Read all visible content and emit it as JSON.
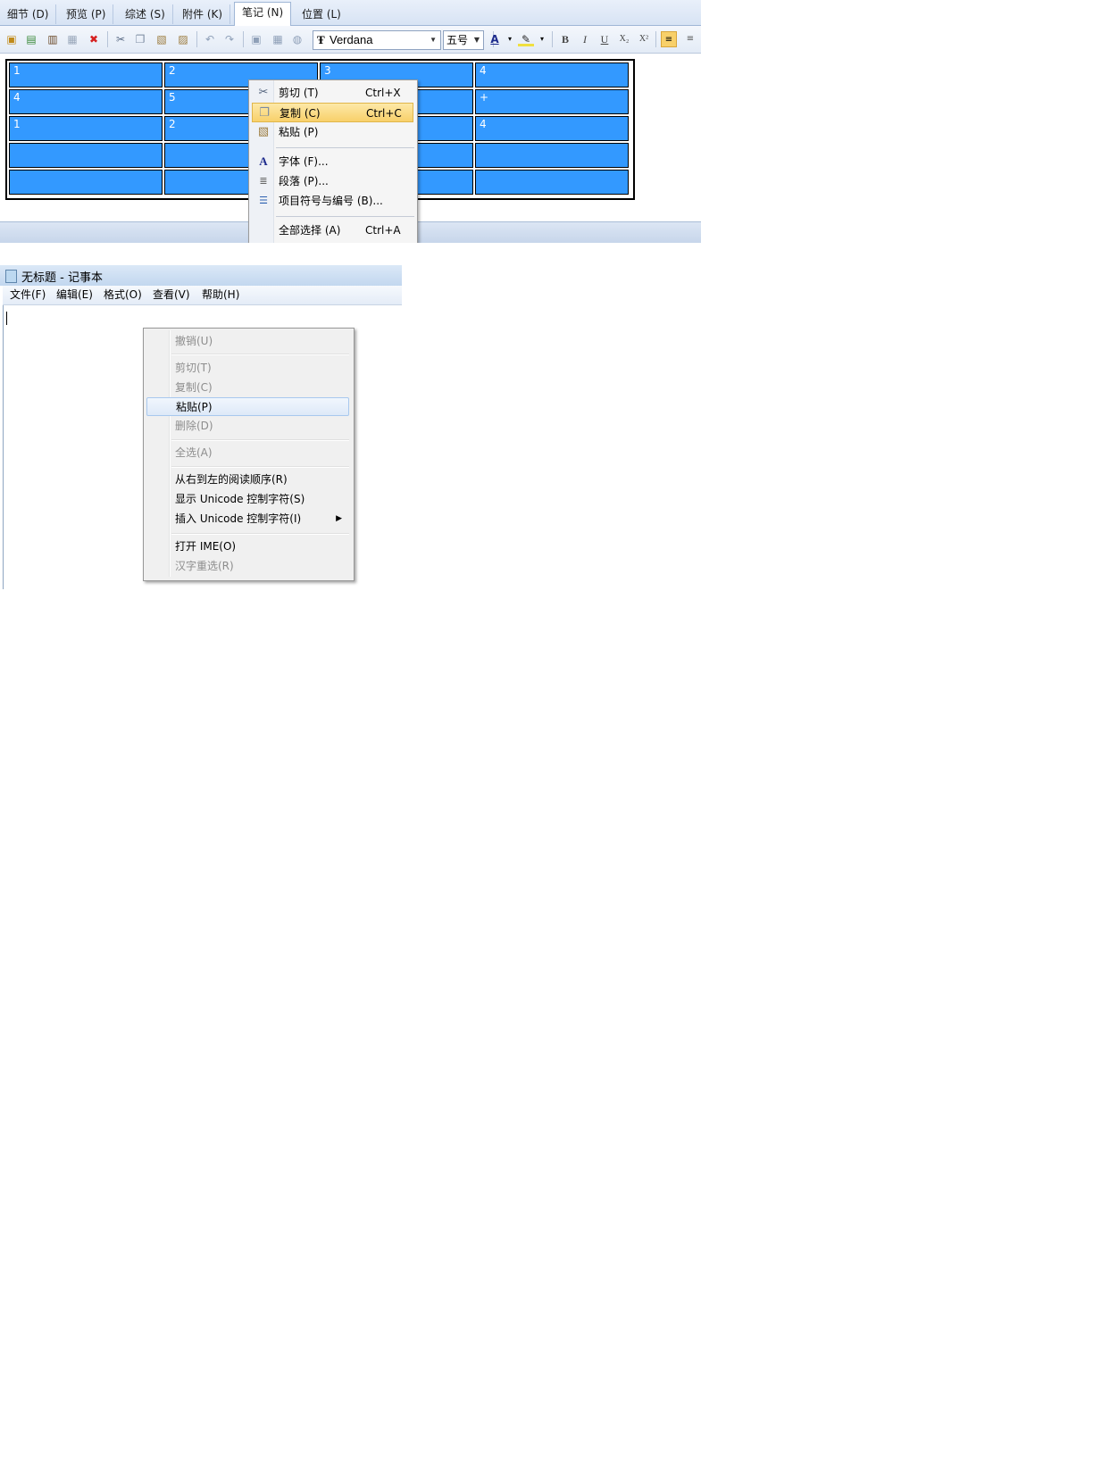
{
  "editor": {
    "tabs": [
      {
        "label": "细节 (D)"
      },
      {
        "label": "预览 (P)"
      },
      {
        "label": "综述 (S)"
      },
      {
        "label": "附件 (K)"
      },
      {
        "label": "笔记 (N)"
      },
      {
        "label": "位置 (L)"
      }
    ],
    "active_tab": "笔记 (N)",
    "toolbar": {
      "font_name": "Verdana",
      "font_size": "五号",
      "bold": "B",
      "italic": "I",
      "underline": "U",
      "subscript": "X₂",
      "superscript": "X²"
    },
    "table": {
      "rows": [
        [
          "1",
          "2",
          "3",
          "4"
        ],
        [
          "4",
          "5",
          "",
          "+"
        ],
        [
          "1",
          "2",
          "",
          "4"
        ],
        [
          "",
          "",
          "",
          ""
        ],
        [
          "",
          "",
          "",
          ""
        ]
      ]
    },
    "context_menu": {
      "items": [
        {
          "label": "剪切 (T)",
          "shortcut": "Ctrl+X",
          "icon": "scissors-icon"
        },
        {
          "label": "复制 (C)",
          "shortcut": "Ctrl+C",
          "icon": "copy-icon",
          "highlighted": true
        },
        {
          "label": "粘贴 (P)",
          "shortcut": "",
          "icon": "paste-icon"
        },
        {
          "label": "字体 (F)...",
          "shortcut": "",
          "icon": "font-icon"
        },
        {
          "label": "段落 (P)...",
          "shortcut": "",
          "icon": "paragraph-icon"
        },
        {
          "label": "项目符号与编号 (B)...",
          "shortcut": "",
          "icon": "bullets-icon"
        },
        {
          "label": "全部选择 (A)",
          "shortcut": "Ctrl+A",
          "icon": ""
        }
      ]
    }
  },
  "notepad": {
    "title": "无标题 - 记事本",
    "menubar": [
      {
        "label": "文件(F)"
      },
      {
        "label": "编辑(E)"
      },
      {
        "label": "格式(O)"
      },
      {
        "label": "查看(V)"
      },
      {
        "label": "帮助(H)"
      }
    ],
    "context_menu": {
      "items": [
        {
          "label": "撤销(U)",
          "disabled": true
        },
        {
          "label": "剪切(T)",
          "disabled": true
        },
        {
          "label": "复制(C)",
          "disabled": true
        },
        {
          "label": "粘贴(P)",
          "disabled": false,
          "highlighted": true
        },
        {
          "label": "删除(D)",
          "disabled": true
        },
        {
          "label": "全选(A)",
          "disabled": true
        },
        {
          "label": "从右到左的阅读顺序(R)",
          "disabled": false
        },
        {
          "label": "显示 Unicode 控制字符(S)",
          "disabled": false
        },
        {
          "label": "插入 Unicode 控制字符(I)",
          "disabled": false,
          "submenu": true
        },
        {
          "label": "打开 IME(O)",
          "disabled": false
        },
        {
          "label": "汉字重选(R)",
          "disabled": true
        }
      ]
    }
  },
  "colors": {
    "table_cell": "#3399ff",
    "menu_highlight": "#f8d06a",
    "notepad_highlight": "#dde9f8"
  }
}
